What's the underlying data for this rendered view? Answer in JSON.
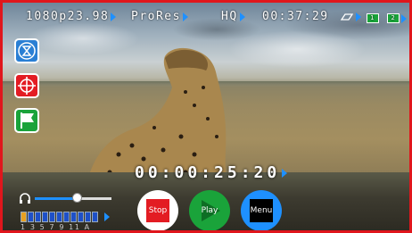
{
  "status_bar": {
    "format": "1080p23.98",
    "codec": "ProRes",
    "quality": "HQ",
    "remaining_time": "00:37:29",
    "battery_1": "1",
    "battery_2": "2"
  },
  "timecode": "00:00:25:20",
  "controls": {
    "stop_label": "Stop",
    "play_label": "Play",
    "menu_label": "Menu"
  },
  "audio": {
    "channel_labels": "1 3 5 7 9 11 A",
    "volume_level": 0.55
  },
  "colors": {
    "accent": "#1e90ff",
    "border": "#e0161c",
    "stop": "#e31c23",
    "play": "#1aa33a",
    "menu": "#1e90ff"
  }
}
